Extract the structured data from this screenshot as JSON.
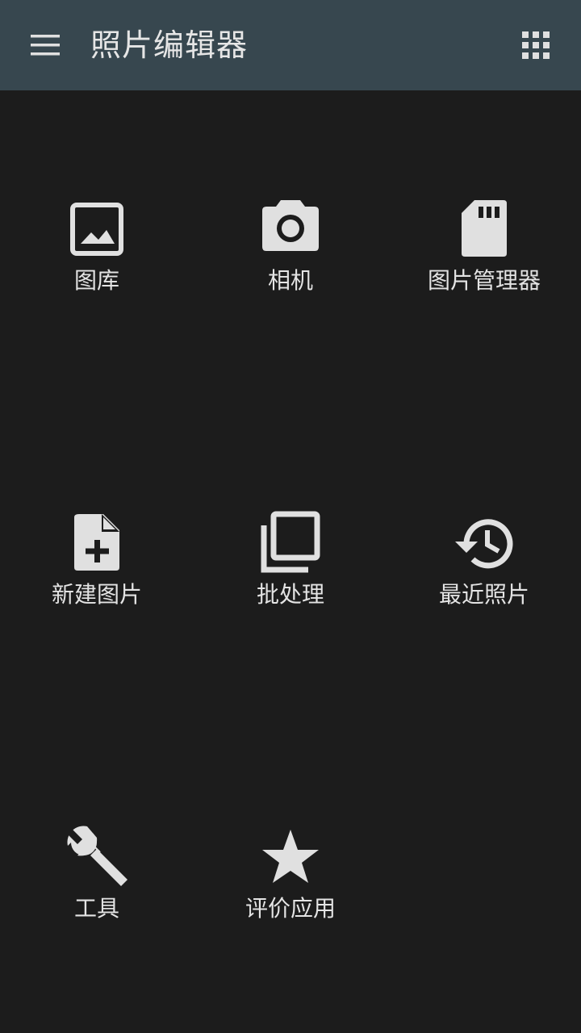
{
  "app_bar": {
    "title": "照片编辑器",
    "menu_icon": "menu-icon",
    "apps_icon": "apps-grid-icon",
    "background_color": "#37474f"
  },
  "colors": {
    "background": "#1c1c1c",
    "icon": "#e0e0e0",
    "text": "#e4e4e4"
  },
  "grid": {
    "items": [
      {
        "label": "图库",
        "icon": "gallery-icon"
      },
      {
        "label": "相机",
        "icon": "camera-icon"
      },
      {
        "label": "图片管理器",
        "icon": "sd-card-icon"
      },
      {
        "label": "新建图片",
        "icon": "new-file-icon"
      },
      {
        "label": "批处理",
        "icon": "batch-icon"
      },
      {
        "label": "最近照片",
        "icon": "history-icon"
      },
      {
        "label": "工具",
        "icon": "wrench-icon"
      },
      {
        "label": "评价应用",
        "icon": "star-icon"
      }
    ]
  }
}
